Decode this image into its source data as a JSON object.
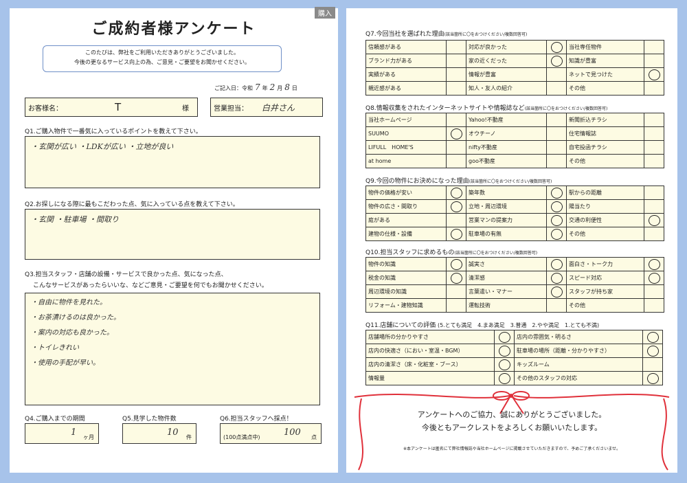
{
  "left": {
    "tag": "購入",
    "title": "ご成約者様アンケート",
    "intro": [
      "このたびは、弊社をご利用いただきありがとうございました。",
      "今後の更なるサービス向上の為、ご意見・ご要望をお聞かせください。"
    ],
    "date": {
      "label": "ご記入日：令和",
      "year": "7",
      "year_unit": "年",
      "month": "2",
      "month_unit": "月",
      "day": "8",
      "day_unit": "日"
    },
    "customer": {
      "label": "お客様名：",
      "value": "T",
      "suffix": "様"
    },
    "staff": {
      "label": "営業担当：",
      "value": "白井さん"
    },
    "q1": {
      "question": "Q1.ご購入物件で一番気に入っているポイントを教えて下さい。",
      "answer": "・玄関が広い ・LDKが広い ・立地が良い"
    },
    "q2": {
      "question": "Q2.お探しになる際に最もこだわった点、気に入っている点を教えて下さい。",
      "answer": "・玄関 ・駐車場 ・間取り"
    },
    "q3": {
      "question_1": "Q3.担当スタッフ・店舗の設備・サービスで良かった点、気になった点、",
      "question_2": "こんなサービスがあったらいいな、などご意見・ご要望を何でもお聞かせください。",
      "answers": [
        "・自由に物件を見れた。",
        "・お茶漬けるのは良かった。",
        "・案内の対応も良かった。",
        "・トイレきれい",
        "・使用の手配が早い。"
      ]
    },
    "q4": {
      "question": "Q4.ご購入までの期間",
      "value": "1",
      "unit": "ヶ月"
    },
    "q5": {
      "question": "Q5.見学した物件数",
      "value": "10",
      "unit": "件"
    },
    "q6": {
      "question": "Q6.担当スタッフへ採点！",
      "note": "(100点満点中)",
      "value": "100",
      "unit": "点"
    }
  },
  "right": {
    "q7": {
      "title": "Q7.今回当社を選ばれた理由",
      "hint": "(該当箇所に〇をおつけください/複数回答可)",
      "rows": [
        [
          "信頼感がある",
          "",
          "対応が良かった",
          "circle",
          "当社専任物件",
          ""
        ],
        [
          "ブランド力がある",
          "",
          "家の近くだった",
          "circle",
          "知識が豊富",
          ""
        ],
        [
          "実績がある",
          "",
          "情報が豊富",
          "",
          "ネットで見つけた",
          "circle"
        ],
        [
          "親近感がある",
          "",
          "知人・友人の紹介",
          "",
          "その他",
          ""
        ]
      ]
    },
    "q8": {
      "title": "Q8.情報収集をされたインターネットサイトや情報誌など",
      "hint": "(該当箇所に〇をおつけください/複数回答可)",
      "rows": [
        [
          "当社ホームページ",
          "",
          "Yahoo!不動産",
          "",
          "新聞折込チラシ",
          ""
        ],
        [
          "SUUMO",
          "circle",
          "オウチーノ",
          "",
          "住宅情報誌",
          ""
        ],
        [
          "LIFULL　HOME'S",
          "",
          "nifty不動産",
          "",
          "自宅投函チラシ",
          ""
        ],
        [
          "at home",
          "",
          "goo不動産",
          "",
          "その他",
          ""
        ]
      ]
    },
    "q9": {
      "title": "Q9.今回の物件にお決めになった理由",
      "hint": "(該当箇所に〇をおつけください/複数回答可)",
      "rows": [
        [
          "物件の価格が安い",
          "circle",
          "築年数",
          "circle",
          "駅からの距離",
          ""
        ],
        [
          "物件の広さ・間取り",
          "circle",
          "立地・周辺環境",
          "circle",
          "陽当たり",
          ""
        ],
        [
          "庭がある",
          "",
          "営業マンの提案力",
          "circle",
          "交通の利便性",
          "circle"
        ],
        [
          "建物の仕様・設備",
          "circle",
          "駐車場の有無",
          "circle",
          "その他",
          ""
        ]
      ]
    },
    "q10": {
      "title": "Q10.担当スタッフに求めるもの",
      "hint": "(該当箇所に〇をおつけください/複数回答可)",
      "rows": [
        [
          "物件の知識",
          "circle",
          "誠実さ",
          "circle",
          "面白さ・トーク力",
          "circle"
        ],
        [
          "税金の知識",
          "circle",
          "清潔感",
          "circle",
          "スピード対応",
          "circle"
        ],
        [
          "周辺環境の知識",
          "",
          "言葉遣い・マナー",
          "circle",
          "スタッフが持ち家",
          ""
        ],
        [
          "リフォーム・建物知識",
          "",
          "運転技術",
          "",
          "その他",
          ""
        ]
      ]
    },
    "q11": {
      "title": "Q11.店舗についての評価",
      "scale": "(5.とても満足　4.まあ満足　3.普通　2.やや満足　1.とても不満)",
      "rows": [
        [
          "店舗場所の分かりやすさ",
          "circle",
          "店内の雰囲気・明るさ",
          "circle"
        ],
        [
          "店内の快適さ（におい・室温・BGM）",
          "circle",
          "駐車場の場所（距離・分かりやすさ）",
          "circle"
        ],
        [
          "店内の清潔さ（床・化粧室・ブース）",
          "circle",
          "キッズルーム",
          ""
        ],
        [
          "情報量",
          "circle",
          "その他のスタッフの対応",
          "circle"
        ]
      ]
    },
    "closing": [
      "アンケートへのご協力、誠にありがとうございました。",
      "今後ともアークレストをよろしくお願いいたします。"
    ],
    "note": "※本アンケートは匿名にて弊社情報誌や当社ホームページに掲載させていただきますので、予めご了承くださいませ。"
  },
  "colors": {
    "frame": "#a7c3ea",
    "fill": "#fdfbe3",
    "ribbon": "#e0303a"
  }
}
